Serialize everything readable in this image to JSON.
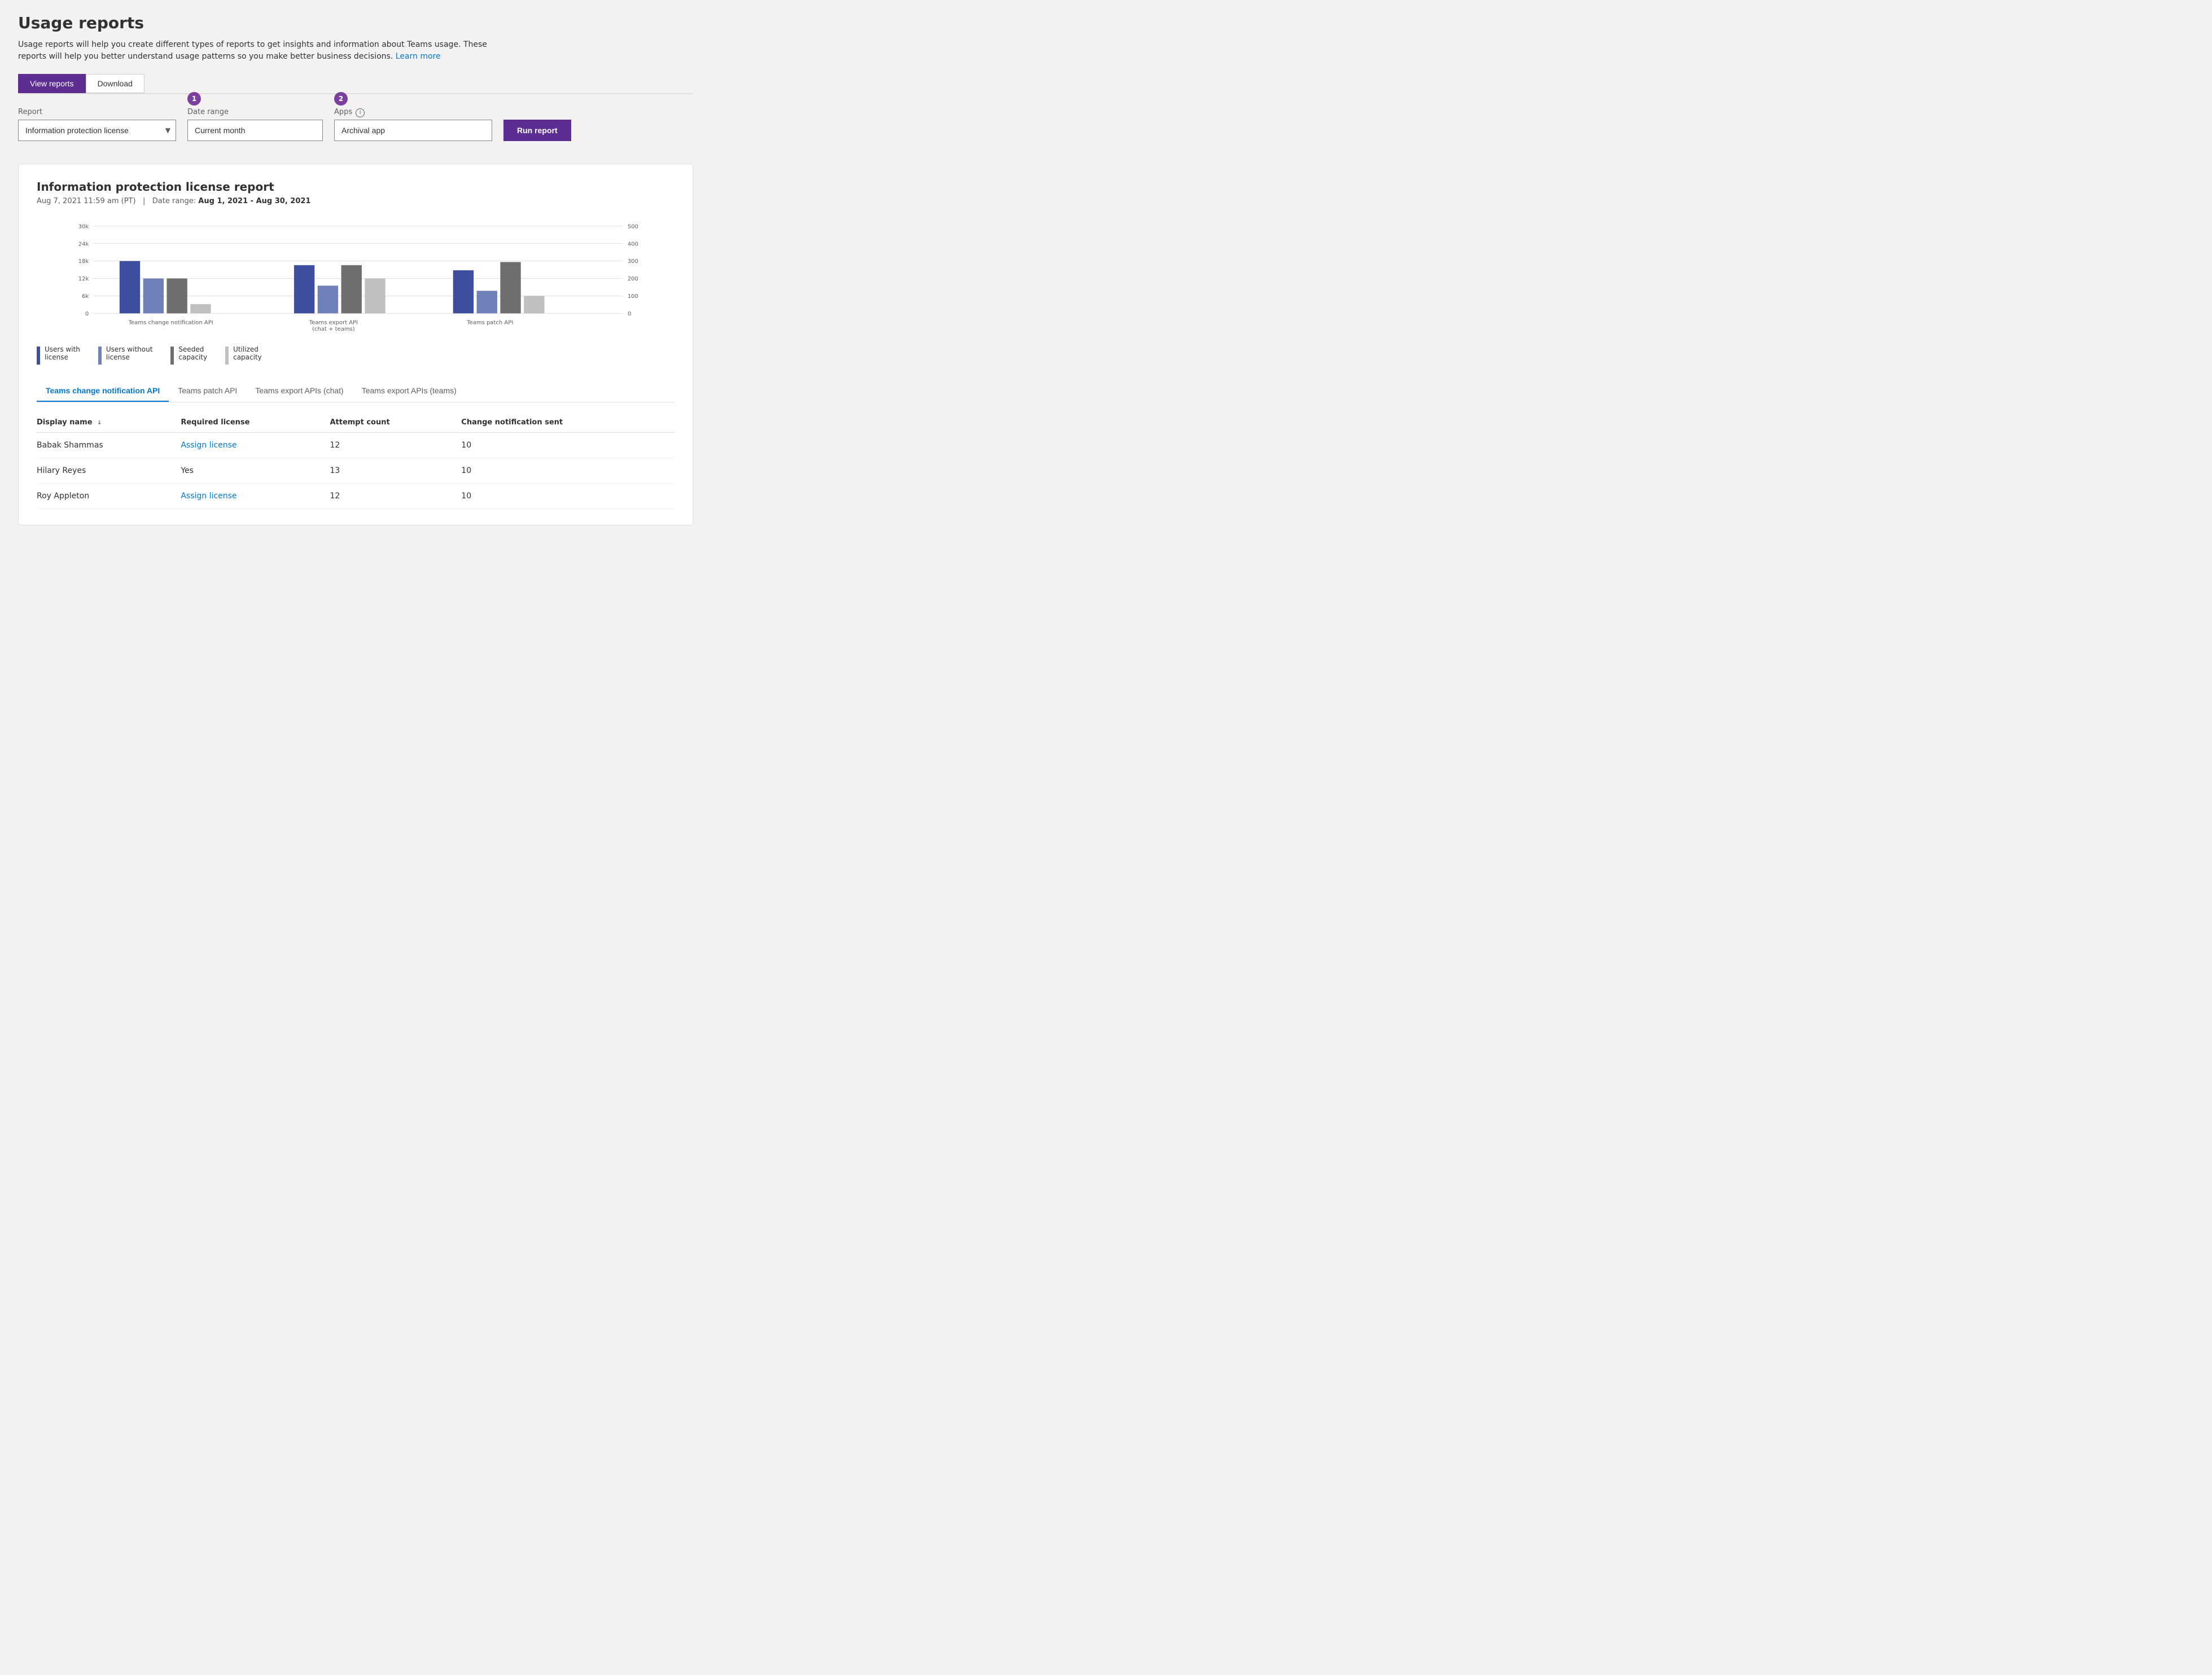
{
  "page": {
    "title": "Usage reports",
    "description": "Usage reports will help you create different types of reports to get insights and information about Teams usage. These reports will help you better understand usage patterns so you make better business decisions.",
    "learn_more": "Learn more"
  },
  "tabs": {
    "view_reports": "View reports",
    "download": "Download"
  },
  "controls": {
    "report_label": "Report",
    "report_value": "Information protection license",
    "date_range_label": "Date range",
    "date_range_value": "Current month",
    "apps_label": "Apps",
    "apps_value": "Archival app",
    "run_report_label": "Run report",
    "step1_badge": "1",
    "step2_badge": "2"
  },
  "report": {
    "title": "Information protection license report",
    "date": "Aug 7, 2021",
    "time": "11:59 am (PT)",
    "separator": "|",
    "date_range_label": "Date range:",
    "date_range_value": "Aug 1, 2021 - Aug 30, 2021"
  },
  "chart": {
    "left_axis": [
      "30k",
      "24k",
      "18k",
      "12k",
      "6k",
      "0"
    ],
    "right_axis": [
      "500",
      "400",
      "300",
      "200",
      "100",
      "0"
    ],
    "groups": [
      {
        "label": "Teams change notification API"
      },
      {
        "label": "Teams export API\n(chat + teams)"
      },
      {
        "label": "Teams patch API"
      }
    ]
  },
  "legend": [
    {
      "label": "Users with\nlicense",
      "color": "#4557a0",
      "display": "Users with license"
    },
    {
      "label": "Users without\nlicense",
      "color": "#7080b8",
      "display": "Users without license"
    },
    {
      "label": "Seeded\ncapacity",
      "color": "#6e6e6e",
      "display": "Seeded capacity"
    },
    {
      "label": "Utilized\ncapacity",
      "color": "#c8c8c8",
      "display": "Utilized capacity"
    }
  ],
  "data_tabs": [
    {
      "label": "Teams change notification API",
      "active": true
    },
    {
      "label": "Teams patch API",
      "active": false
    },
    {
      "label": "Teams export APIs (chat)",
      "active": false
    },
    {
      "label": "Teams export APIs (teams)",
      "active": false
    }
  ],
  "table": {
    "columns": [
      {
        "label": "Display name",
        "sort": "↓"
      },
      {
        "label": "Required license",
        "sort": ""
      },
      {
        "label": "Attempt count",
        "sort": ""
      },
      {
        "label": "Change notification sent",
        "sort": ""
      }
    ],
    "rows": [
      {
        "name": "Babak Shammas",
        "license": "Assign license",
        "license_link": true,
        "attempts": "12",
        "sent": "10"
      },
      {
        "name": "Hilary Reyes",
        "license": "Yes",
        "license_link": false,
        "attempts": "13",
        "sent": "10"
      },
      {
        "name": "Roy Appleton",
        "license": "Assign license",
        "license_link": true,
        "attempts": "12",
        "sent": "10"
      }
    ]
  },
  "colors": {
    "primary_purple": "#5c2e91",
    "accent_blue": "#0078d4",
    "bar_dark_blue": "#3d4f9e",
    "bar_medium_blue": "#6b7dbf",
    "bar_dark_gray": "#696969",
    "bar_light_gray": "#c0c0c0"
  }
}
